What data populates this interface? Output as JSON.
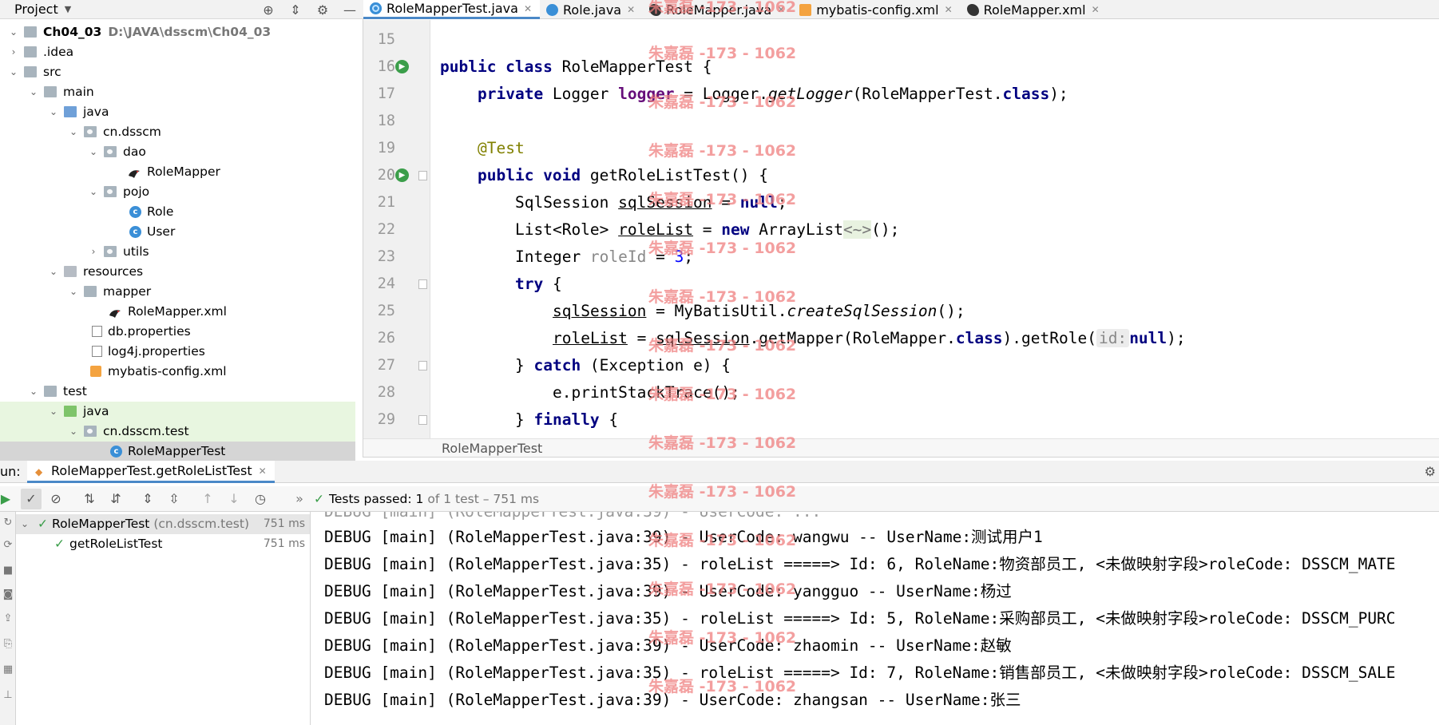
{
  "project": {
    "title": "Project",
    "tree": [
      {
        "label": "Ch04_03",
        "path": "D:\\JAVA\\dsscm\\Ch04_03",
        "bold": true
      },
      {
        "label": ".idea"
      },
      {
        "label": "src"
      },
      {
        "label": "main"
      },
      {
        "label": "java"
      },
      {
        "label": "cn.dsscm"
      },
      {
        "label": "dao"
      },
      {
        "label": "RoleMapper"
      },
      {
        "label": "pojo"
      },
      {
        "label": "Role"
      },
      {
        "label": "User"
      },
      {
        "label": "utils"
      },
      {
        "label": "resources"
      },
      {
        "label": "mapper"
      },
      {
        "label": "RoleMapper.xml"
      },
      {
        "label": "db.properties"
      },
      {
        "label": "log4j.properties"
      },
      {
        "label": "mybatis-config.xml"
      },
      {
        "label": "test"
      },
      {
        "label": "java"
      },
      {
        "label": "cn.dsscm.test"
      },
      {
        "label": "RoleMapperTest"
      }
    ]
  },
  "tabs": [
    {
      "label": "RoleMapperTest.java"
    },
    {
      "label": "Role.java"
    },
    {
      "label": "RoleMapper.java"
    },
    {
      "label": "mybatis-config.xml"
    },
    {
      "label": "RoleMapper.xml"
    }
  ],
  "editor": {
    "line_numbers": [
      "15",
      "16",
      "17",
      "18",
      "19",
      "20",
      "21",
      "22",
      "23",
      "24",
      "25",
      "26",
      "27",
      "28",
      "29"
    ],
    "breadcrumb": "RoleMapperTest",
    "code": {
      "l16": {
        "kw": "public class",
        "rest": " RoleMapperTest {"
      },
      "l17": {
        "kw": "private",
        "t1": " Logger ",
        "field": "logger",
        "t2": " = Logger.",
        "method": "getLogger",
        "t3": "(RoleMapperTest.",
        "kw2": "class",
        "t4": ");"
      },
      "l19": {
        "ann": "@Test"
      },
      "l20": {
        "kw": "public void",
        "rest": " getRoleListTest() {"
      },
      "l21": {
        "t1": "SqlSession ",
        "var": "sqlSession",
        "t2": " = ",
        "kw": "null",
        "t3": ";"
      },
      "l22": {
        "t1": "List<Role> ",
        "var": "roleList",
        "t2": " = ",
        "kw": "new",
        "t3": " ArrayList",
        "diamond": "<~>",
        "t4": "();"
      },
      "l23": {
        "t1": "Integer ",
        "var": "roleId",
        "t2": " = ",
        "num": "3",
        "t3": ";"
      },
      "l24": {
        "kw": "try",
        "t1": " {"
      },
      "l25": {
        "var": "sqlSession",
        "t1": " = MyBatisUtil.",
        "method": "createSqlSession",
        "t2": "();"
      },
      "l26": {
        "var": "roleList",
        "t1": " = ",
        "var2": "sqlSession",
        "t2": ".getMapper(RoleMapper.",
        "kw": "class",
        "t3": ").getRole(",
        "hint": "id:",
        "kw2": "null",
        "t4": ");"
      },
      "l27": {
        "t1": "} ",
        "kw": "catch",
        "t2": " (Exception e) {"
      },
      "l28": {
        "t1": "e.printStackTrace();"
      },
      "l29": {
        "t1": "} ",
        "kw": "finally",
        "t2": " {"
      }
    }
  },
  "run": {
    "label": "un:",
    "tab": "RoleMapperTest.getRoleListTest",
    "status": {
      "bold": "Tests passed: 1",
      "rest": "of 1 test – 751 ms"
    },
    "tree": [
      {
        "name": "RoleMapperTest",
        "pkg": "(cn.dsscm.test)",
        "time": "751 ms"
      },
      {
        "name": "getRoleListTest",
        "time": "751 ms"
      }
    ],
    "console": [
      "DEBUG [main] (RoleMapperTest.java:39) - UserCode: wangwu -- UserName:测试用户1",
      "DEBUG [main] (RoleMapperTest.java:35) - roleList =====> Id: 6, RoleName:物资部员工, <未做映射字段>roleCode: DSSCM_MATE",
      "DEBUG [main] (RoleMapperTest.java:39) - UserCode: yangguo -- UserName:杨过",
      "DEBUG [main] (RoleMapperTest.java:35) - roleList =====> Id: 5, RoleName:采购部员工, <未做映射字段>roleCode: DSSCM_PURC",
      "DEBUG [main] (RoleMapperTest.java:39) - UserCode: zhaomin -- UserName:赵敏",
      "DEBUG [main] (RoleMapperTest.java:35) - roleList =====> Id: 7, RoleName:销售部员工, <未做映射字段>roleCode: DSSCM_SALE",
      "DEBUG [main] (RoleMapperTest.java:39) - UserCode: zhangsan -- UserName:张三"
    ]
  },
  "watermark": "朱嘉磊 -173 - 1062"
}
